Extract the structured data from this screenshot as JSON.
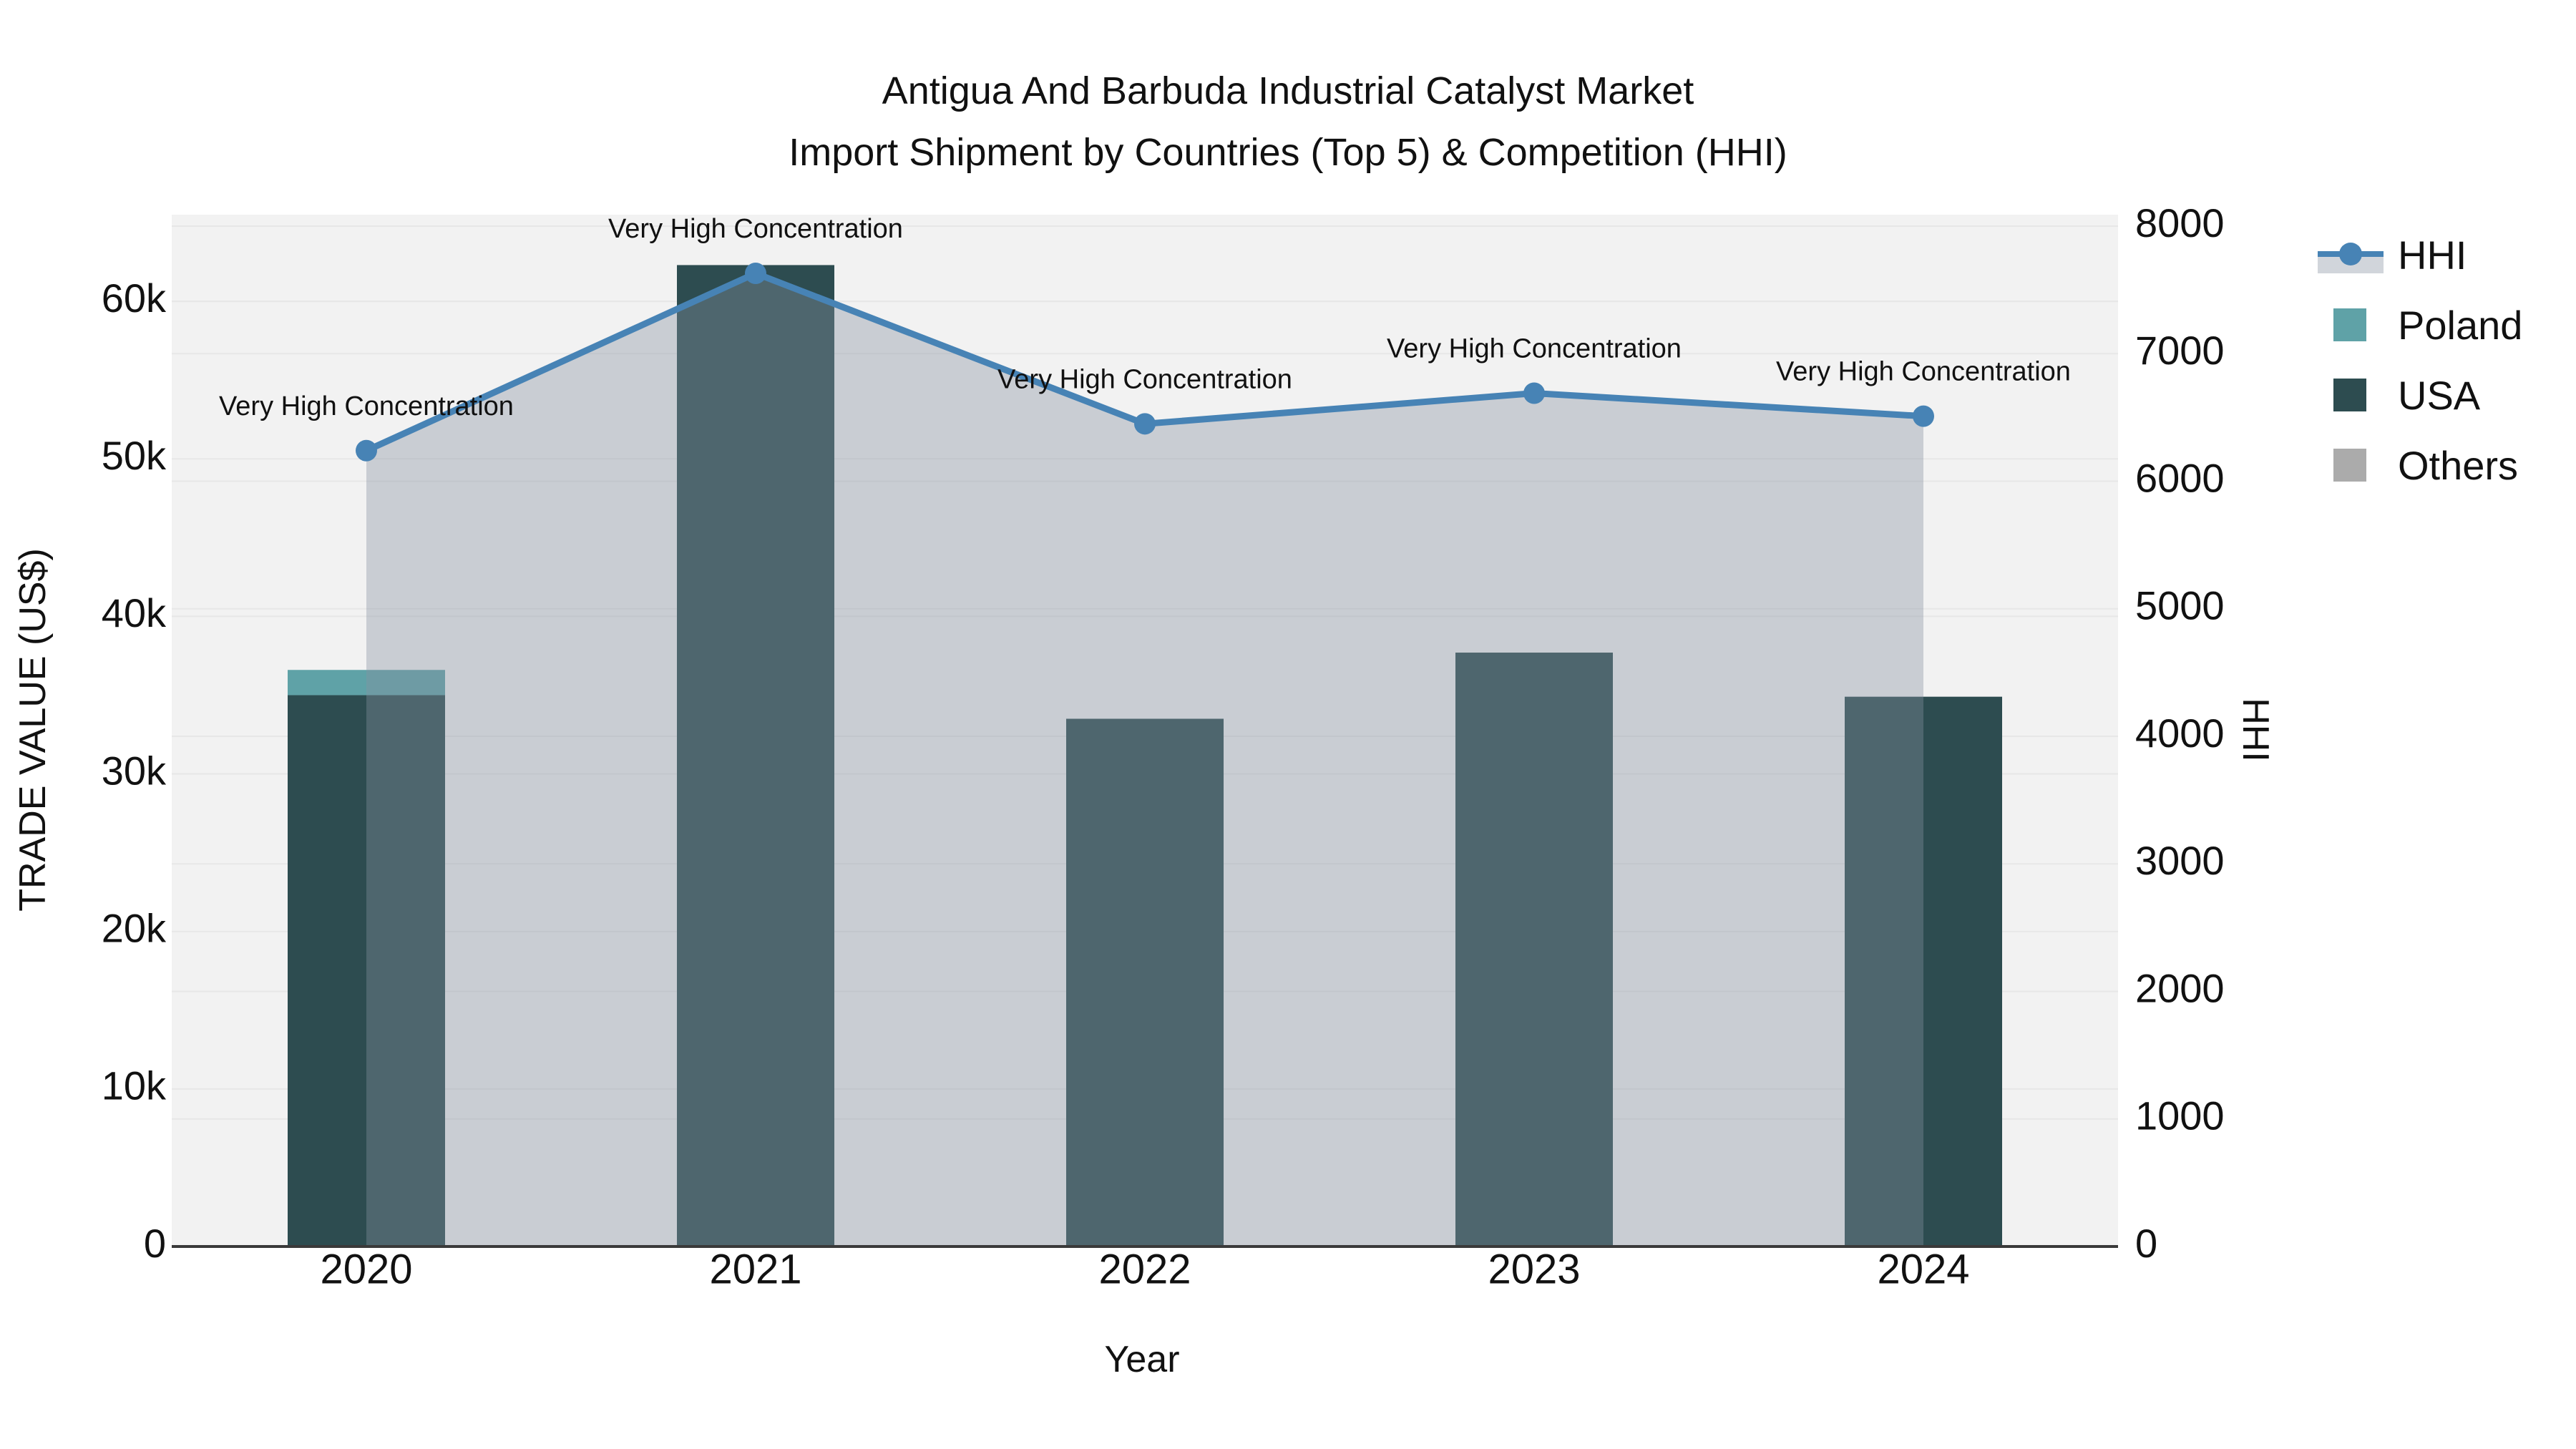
{
  "figure": {
    "title_line1": "Antigua And Barbuda Industrial Catalyst Market",
    "title_line2": "Import Shipment by Countries (Top 5) & Competition (HHI)"
  },
  "chart_data": {
    "type": "bar+line",
    "title": "Antigua And Barbuda Industrial Catalyst Market Import Shipment by Countries (Top 5) & Competition (HHI)",
    "categories": [
      "2020",
      "2021",
      "2022",
      "2023",
      "2024"
    ],
    "bar_series": [
      {
        "name": "USA",
        "color": "#2D4C50",
        "values": [
          35000,
          62300,
          33500,
          37700,
          34900
        ]
      },
      {
        "name": "Poland",
        "color": "#5FA2A7",
        "values": [
          1600,
          0,
          0,
          0,
          0
        ]
      },
      {
        "name": "Others",
        "color": "#ABABAB",
        "values": [
          0,
          0,
          0,
          0,
          0
        ]
      }
    ],
    "line_series": {
      "name": "HHI",
      "color": "#4783B5",
      "area_color": "rgba(133,144,161,0.38)",
      "values": [
        6240,
        7630,
        6450,
        6690,
        6510
      ]
    },
    "point_labels": [
      "Very High Concentration",
      "Very High Concentration",
      "Very High Concentration",
      "Very High Concentration",
      "Very High Concentration"
    ],
    "axes": {
      "x": {
        "title": "Year"
      },
      "left": {
        "title": "TRADE VALUE (US$)",
        "max": 65500,
        "ticks": [
          {
            "v": 0,
            "label": "0"
          },
          {
            "v": 10000,
            "label": "10k"
          },
          {
            "v": 20000,
            "label": "20k"
          },
          {
            "v": 30000,
            "label": "30k"
          },
          {
            "v": 40000,
            "label": "40k"
          },
          {
            "v": 50000,
            "label": "50k"
          },
          {
            "v": 60000,
            "label": "60k"
          }
        ]
      },
      "right": {
        "title": "HHI",
        "max": 8090,
        "ticks": [
          {
            "v": 0,
            "label": "0"
          },
          {
            "v": 1000,
            "label": "1000"
          },
          {
            "v": 2000,
            "label": "2000"
          },
          {
            "v": 3000,
            "label": "3000"
          },
          {
            "v": 4000,
            "label": "4000"
          },
          {
            "v": 5000,
            "label": "5000"
          },
          {
            "v": 6000,
            "label": "6000"
          },
          {
            "v": 7000,
            "label": "7000"
          },
          {
            "v": 8000,
            "label": "8000"
          }
        ]
      }
    },
    "legend": {
      "items": [
        {
          "label": "HHI",
          "type": "line"
        },
        {
          "label": "Poland",
          "type": "swatch",
          "color": "#5FA2A7"
        },
        {
          "label": "USA",
          "type": "swatch",
          "color": "#2D4C50"
        },
        {
          "label": "Others",
          "type": "swatch",
          "color": "#ABABAB"
        }
      ]
    },
    "style": {
      "plot_bg": "#F2F2F2",
      "grid_color": "#E7E7E7",
      "axis_line_color": "#3A3A3A",
      "text_color": "#111111"
    }
  }
}
